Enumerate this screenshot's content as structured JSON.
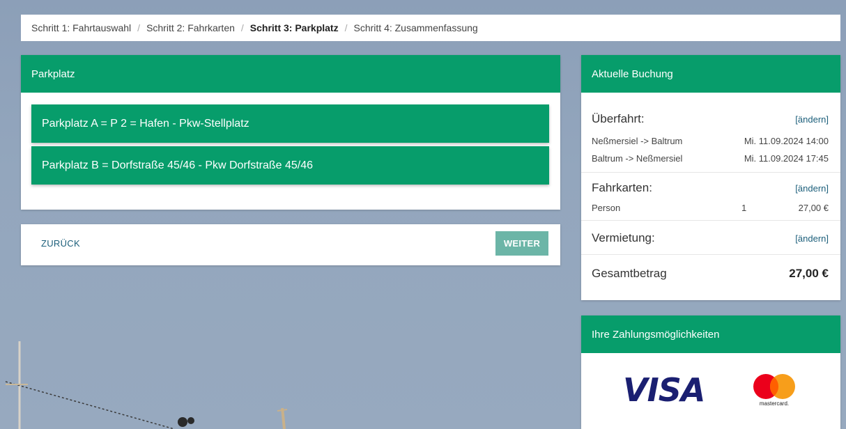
{
  "breadcrumb": {
    "step1": "Schritt 1: Fahrtauswahl",
    "step2": "Schritt 2: Fahrkarten",
    "step3": "Schritt 3: Parkplatz",
    "step4": "Schritt 4: Zusammenfassung",
    "separator": "/"
  },
  "parking": {
    "title": "Parkplatz",
    "options": [
      "Parkplatz A = P 2 = Hafen - Pkw-Stellplatz",
      "Parkplatz B = Dorfstraße 45/46 - Pkw Dorfstraße 45/46"
    ]
  },
  "nav": {
    "back": "ZURÜCK",
    "next": "WEITER"
  },
  "booking": {
    "title": "Aktuelle Buchung",
    "crossing_label": "Überfahrt:",
    "change": "[ändern]",
    "trips": [
      {
        "route": "Neßmersiel -> Baltrum",
        "date": "Mi. 11.09.2024 14:00"
      },
      {
        "route": "Baltrum -> Neßmersiel",
        "date": "Mi. 11.09.2024 17:45"
      }
    ],
    "tickets_label": "Fahrkarten:",
    "ticket_row": {
      "type": "Person",
      "qty": "1",
      "price": "27,00 €"
    },
    "rental_label": "Vermietung:",
    "total_label": "Gesamtbetrag",
    "total_value": "27,00 €"
  },
  "payment": {
    "title": "Ihre Zahlungsmöglichkeiten",
    "visa": "VISA",
    "mastercard": "mastercard."
  },
  "colors": {
    "accent": "#079d6b",
    "link": "#1b5e7a",
    "next_button": "#6cb5a7",
    "visa_blue": "#1a1f71",
    "mc_red": "#eb001b",
    "mc_orange": "#f79e1b"
  }
}
